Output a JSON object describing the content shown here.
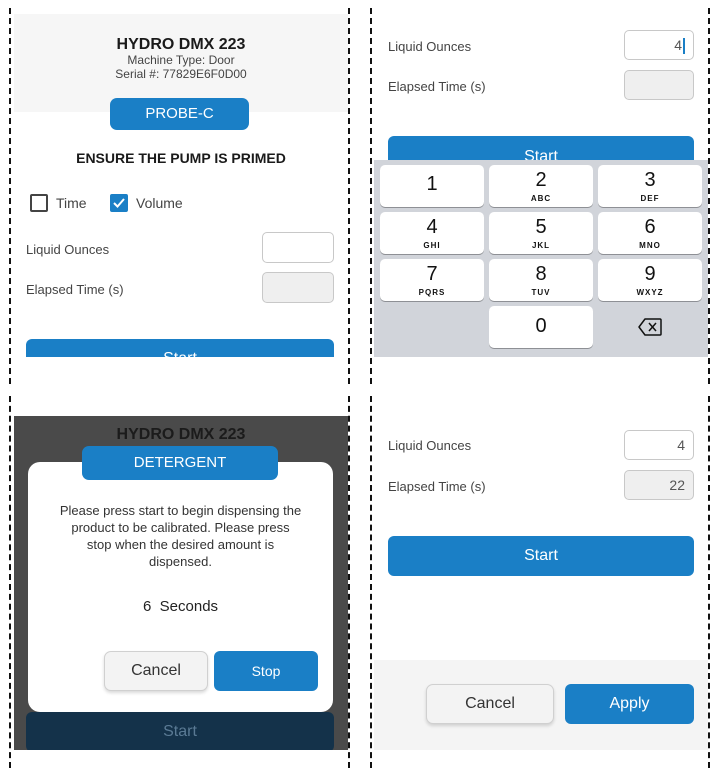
{
  "panel1": {
    "machine_title": "HYDRO DMX 223",
    "machine_type": "Machine Type: Door",
    "serial": "Serial #: 77829E6F0D00",
    "product_button": "PROBE-C",
    "prime_notice": "ENSURE THE PUMP IS PRIMED",
    "time_option": "Time",
    "volume_option": "Volume",
    "time_checked": false,
    "volume_checked": true,
    "liquid_label": "Liquid Ounces",
    "liquid_value": "",
    "elapsed_label": "Elapsed Time (s)",
    "elapsed_value": "",
    "start_label": "Start"
  },
  "panel2": {
    "liquid_label": "Liquid Ounces",
    "liquid_value": "4",
    "elapsed_label": "Elapsed Time (s)",
    "elapsed_value": "",
    "start_label": "Start",
    "keys": [
      {
        "num": "1",
        "letters": ""
      },
      {
        "num": "2",
        "letters": "ABC"
      },
      {
        "num": "3",
        "letters": "DEF"
      },
      {
        "num": "4",
        "letters": "GHI"
      },
      {
        "num": "5",
        "letters": "JKL"
      },
      {
        "num": "6",
        "letters": "MNO"
      },
      {
        "num": "7",
        "letters": "PQRS"
      },
      {
        "num": "8",
        "letters": "TUV"
      },
      {
        "num": "9",
        "letters": "WXYZ"
      },
      {
        "num": "0",
        "letters": ""
      }
    ],
    "delete_icon": "backspace-icon"
  },
  "panel3": {
    "machine_title": "HYDRO DMX 223",
    "dialog_title": "DETERGENT",
    "message": "Please press start to begin dispensing the product to be calibrated. Please press stop when the desired amount is dispensed.",
    "seconds_value": "6",
    "seconds_label": "Seconds",
    "cancel_label": "Cancel",
    "stop_label": "Stop",
    "start_label": "Start"
  },
  "panel4": {
    "liquid_label": "Liquid Ounces",
    "liquid_value": "4",
    "elapsed_label": "Elapsed Time (s)",
    "elapsed_value": "22",
    "start_label": "Start",
    "cancel_label": "Cancel",
    "apply_label": "Apply"
  },
  "colors": {
    "accent": "#1a7fc6",
    "keypad_bg": "#d1d4da",
    "dim_overlay": "#4a4a4a"
  }
}
